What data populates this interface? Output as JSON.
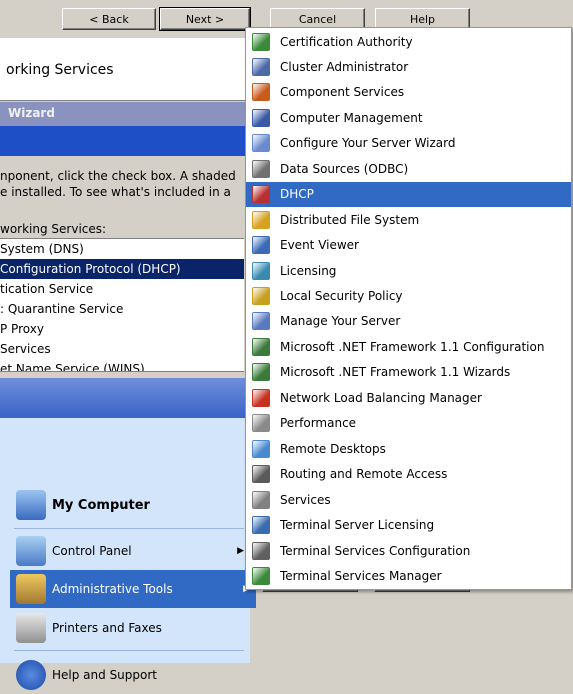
{
  "wizard": {
    "back_label": "< Back",
    "next_label": "Next >",
    "cancel_label": "Cancel",
    "help_label": "Help",
    "title": "orking Services",
    "header_label": "Wizard",
    "description_line1": "nponent, click the check box. A shaded",
    "description_line2": "e installed. To see what's included in a",
    "list_label": "working Services:",
    "services": [
      "System (DNS)",
      "Configuration Protocol (DHCP)",
      "tication Service",
      ": Quarantine Service",
      "P Proxy",
      "Services",
      "et Name Service (WINS)"
    ],
    "selected_service_index": 1
  },
  "start_menu": {
    "my_computer": "My Computer",
    "control_panel": "Control Panel",
    "admin_tools": "Administrative Tools",
    "printers": "Printers and Faxes",
    "help": "Help and Support"
  },
  "admin_menu": {
    "selected_index": 6,
    "items": [
      {
        "label": "Certification Authority",
        "icon": "certificate-icon",
        "color": "#3a8a3a"
      },
      {
        "label": "Cluster Administrator",
        "icon": "cluster-icon",
        "color": "#4a6aa8"
      },
      {
        "label": "Component Services",
        "icon": "component-icon",
        "color": "#c85a1a"
      },
      {
        "label": "Computer Management",
        "icon": "computer-management-icon",
        "color": "#3a5aa8"
      },
      {
        "label": "Configure Your Server Wizard",
        "icon": "wizard-icon",
        "color": "#6a8ad0"
      },
      {
        "label": "Data Sources (ODBC)",
        "icon": "database-icon",
        "color": "#707070"
      },
      {
        "label": "DHCP",
        "icon": "dhcp-icon",
        "color": "#b83030"
      },
      {
        "label": "Distributed File System",
        "icon": "dfs-icon",
        "color": "#d8a020"
      },
      {
        "label": "Event Viewer",
        "icon": "event-viewer-icon",
        "color": "#3a6ab8"
      },
      {
        "label": "Licensing",
        "icon": "licensing-icon",
        "color": "#3a8ab0"
      },
      {
        "label": "Local Security Policy",
        "icon": "security-policy-icon",
        "color": "#c8a020"
      },
      {
        "label": "Manage Your Server",
        "icon": "manage-server-icon",
        "color": "#5a7ac0"
      },
      {
        "label": "Microsoft .NET Framework 1.1 Configuration",
        "icon": "dotnet-config-icon",
        "color": "#3a7a3a"
      },
      {
        "label": "Microsoft .NET Framework 1.1 Wizards",
        "icon": "dotnet-wizard-icon",
        "color": "#3a7a3a"
      },
      {
        "label": "Network Load Balancing Manager",
        "icon": "nlb-icon",
        "color": "#c83020"
      },
      {
        "label": "Performance",
        "icon": "performance-icon",
        "color": "#8a8a8a"
      },
      {
        "label": "Remote Desktops",
        "icon": "remote-desktop-icon",
        "color": "#4a8ad0"
      },
      {
        "label": "Routing and Remote Access",
        "icon": "routing-icon",
        "color": "#5a5a5a"
      },
      {
        "label": "Services",
        "icon": "services-icon",
        "color": "#808080"
      },
      {
        "label": "Terminal Server Licensing",
        "icon": "ts-licensing-icon",
        "color": "#3a6ab0"
      },
      {
        "label": "Terminal Services Configuration",
        "icon": "ts-config-icon",
        "color": "#606060"
      },
      {
        "label": "Terminal Services Manager",
        "icon": "ts-manager-icon",
        "color": "#3a8a3a"
      }
    ]
  },
  "colors": {
    "selection": "#316ac5",
    "list_selection": "#0a246a",
    "dialog_bg": "#d4d0c8"
  }
}
